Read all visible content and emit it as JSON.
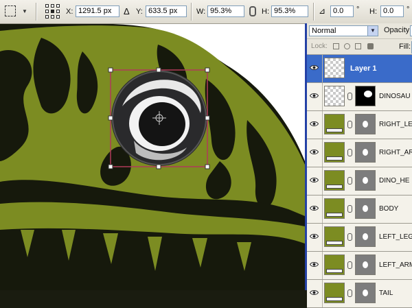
{
  "options_bar": {
    "tool_icon": "marquee-transform-icon",
    "x_label": "X:",
    "x_value": "1291.5 px",
    "delta_icon": "delta-icon",
    "y_label": "Y:",
    "y_value": "633.5 px",
    "w_label": "W:",
    "w_value": "95.3%",
    "link_icon": "chain-link-icon",
    "h_label": "H:",
    "h_value": "95.3%",
    "angle_icon": "rotate-angle-icon",
    "angle_value": "0.0",
    "angle_unit": "°",
    "skew_label": "H:",
    "skew_value": "0.0",
    "skew_unit": "°"
  },
  "layers_panel": {
    "blend_mode": "Normal",
    "opacity_label": "Opacity:",
    "lock_label": "Lock:",
    "fill_label": "Fill:",
    "layers": [
      {
        "name": "Layer 1",
        "selected": true,
        "thumb": "checker",
        "mask": "none"
      },
      {
        "name": "DINOSAU",
        "selected": false,
        "thumb": "checker",
        "mask": "black"
      },
      {
        "name": "RIGHT_LE",
        "selected": false,
        "thumb": "olive",
        "mask": "gray"
      },
      {
        "name": "RIGHT_AR",
        "selected": false,
        "thumb": "olive",
        "mask": "gray"
      },
      {
        "name": "DINO_HE",
        "selected": false,
        "thumb": "olive",
        "mask": "gray"
      },
      {
        "name": "BODY",
        "selected": false,
        "thumb": "olive",
        "mask": "gray"
      },
      {
        "name": "LEFT_LEG",
        "selected": false,
        "thumb": "olive",
        "mask": "gray"
      },
      {
        "name": "LEFT_ARM",
        "selected": false,
        "thumb": "olive",
        "mask": "gray"
      },
      {
        "name": "TAIL",
        "selected": false,
        "thumb": "olive",
        "mask": "gray"
      }
    ]
  },
  "colors": {
    "olive": "#7c8c22",
    "dark": "#16190c",
    "selection_blue": "#3a6bc9",
    "transform_box": "#b03a5a"
  }
}
